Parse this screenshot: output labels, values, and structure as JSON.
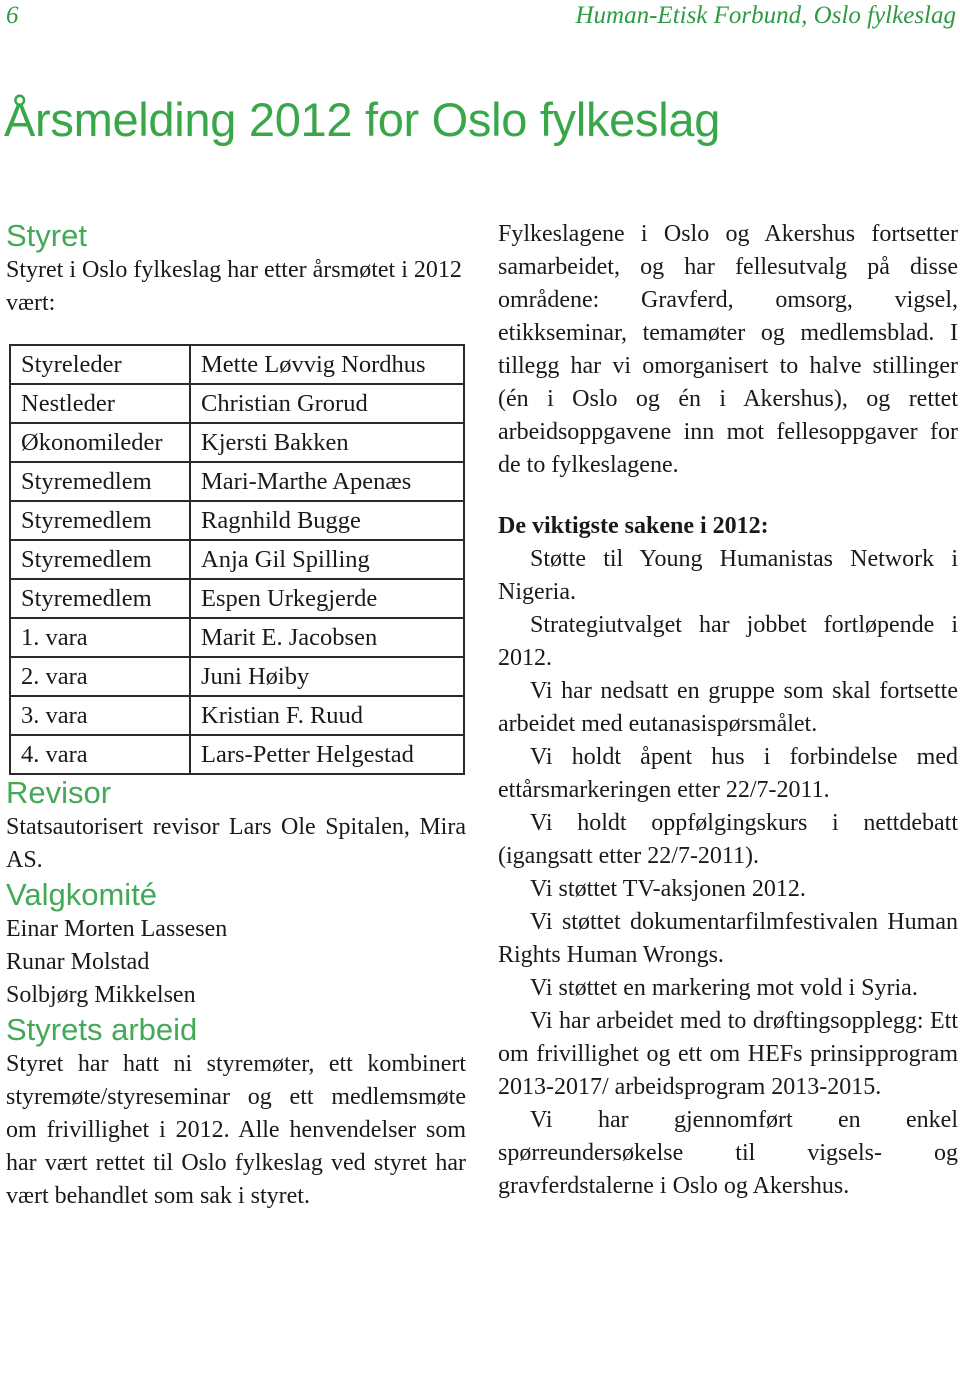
{
  "header": {
    "page_number": "6",
    "running_title": "Human-Etisk Forbund, Oslo fylkeslag"
  },
  "title": "Årsmelding 2012 for Oslo fylkeslag",
  "colors": {
    "accent_green": "#3aa64a",
    "text": "#1a1a1a"
  },
  "styret": {
    "heading": "Styret",
    "intro": "Styret i Oslo fylkeslag har etter årsmøtet i 2012 vært:",
    "board": [
      {
        "role": "Styreleder",
        "name": "Mette Løvvig Nordhus"
      },
      {
        "role": "Nestleder",
        "name": "Christian Grorud"
      },
      {
        "role": "Økonomileder",
        "name": "Kjersti Bakken"
      },
      {
        "role": "Styremedlem",
        "name": "Mari-Marthe Apenæs"
      },
      {
        "role": "Styremedlem",
        "name": "Ragnhild Bugge"
      },
      {
        "role": "Styremedlem",
        "name": "Anja Gil Spilling"
      },
      {
        "role": "Styremedlem",
        "name": "Espen Urkegjerde"
      },
      {
        "role": "1. vara",
        "name": "Marit E. Jacobsen"
      },
      {
        "role": "2. vara",
        "name": "Juni Høiby"
      },
      {
        "role": "3. vara",
        "name": "Kristian F. Ruud"
      },
      {
        "role": "4. vara",
        "name": "Lars-Petter Helgestad"
      }
    ]
  },
  "revisor": {
    "heading": "Revisor",
    "text": "Statsautorisert revisor Lars Ole Spitalen, Mira AS."
  },
  "valgkomite": {
    "heading": "Valgkomité",
    "members": [
      "Einar Morten Lassesen",
      "Runar Molstad",
      "Solbjørg Mikkelsen"
    ]
  },
  "styrets_arbeid": {
    "heading": "Styrets arbeid",
    "text": "Styret har hatt ni styremøter, ett kombinert styremøte/styreseminar og ett medlemsmøte om frivillighet i 2012. Alle henvendelser som har vært rettet til Oslo fylkeslag ved styret har vært behandlet som sak i styret."
  },
  "right": {
    "intro": "Fylkeslagene i Oslo og Akershus fortsetter samarbeidet, og har fellesutvalg på disse områdene: Gravferd, omsorg, vigsel, etikkseminar, temamøter og medlemsblad. I tillegg har vi omorganisert to halve stillinger (én i Oslo og én i Akershus), og rettet arbeidsoppgavene inn mot fellesoppgaver for de to fylkeslagene.",
    "subheading": "De viktigste sakene i 2012:",
    "items": [
      "Støtte til Young Humanistas Network i Nigeria.",
      "Strategiutvalget har jobbet fortløpende i 2012.",
      "Vi har nedsatt en gruppe som skal fortsette arbeidet med eutanasispørsmålet.",
      "Vi holdt åpent hus i forbindelse med ettårsmarkeringen etter 22/7-2011.",
      "Vi holdt oppfølgingskurs i nettdebatt (igangsatt etter 22/7-2011).",
      "Vi støttet TV-aksjonen 2012.",
      "Vi støttet dokumentarfilmfestivalen Human Rights Human Wrongs.",
      "Vi støttet en markering mot vold i Syria.",
      "Vi har arbeidet med to drøftingsopplegg: Ett om frivillighet og ett om HEFs prinsipprogram 2013-2017/ arbeidsprogram 2013-2015.",
      "Vi har gjennomført en enkel spørreundersøkelse til vigsels- og gravferdstalerne i Oslo og Akershus."
    ]
  }
}
